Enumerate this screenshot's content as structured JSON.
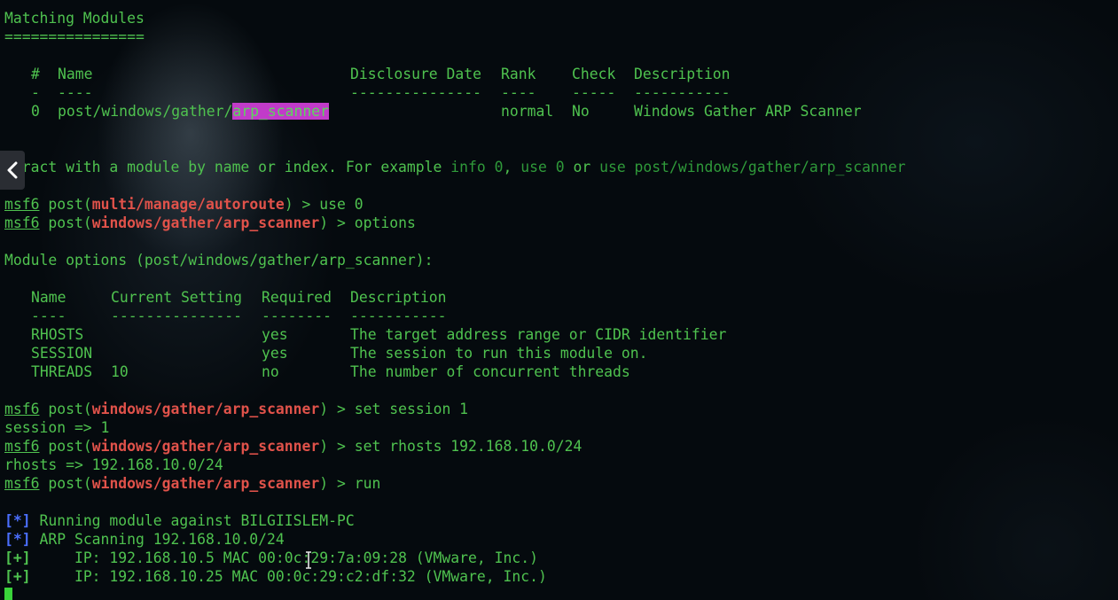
{
  "header": {
    "title": "Matching Modules",
    "underline": "================"
  },
  "modules_table": {
    "columns": [
      "#",
      "Name",
      "Disclosure Date",
      "Rank",
      "Check",
      "Description"
    ],
    "dashes": [
      "-",
      "----",
      "---------------",
      "----",
      "-----",
      "-----------"
    ],
    "rows": [
      {
        "index": "0",
        "name_prefix": "post/windows/gather/",
        "name_match": "arp_scanner",
        "disclosure": "",
        "rank": "normal",
        "check": "No",
        "description": "Windows Gather ARP Scanner"
      }
    ]
  },
  "hint": {
    "p1": "teract with a module by name or index. For example ",
    "e1": "info 0",
    "s1": ", ",
    "e2": "use 0",
    "s2": " or ",
    "e3": "use post/windows/gather/arp_scanner"
  },
  "prompts": [
    {
      "prefix": "msf6",
      "module_open": " post(",
      "module": "multi/manage/autoroute",
      "module_close": ")",
      "cmd": " > use 0"
    },
    {
      "prefix": "msf6",
      "module_open": " post(",
      "module": "windows/gather/arp_scanner",
      "module_close": ")",
      "cmd": " > options"
    }
  ],
  "options_title": "Module options (post/windows/gather/arp_scanner):",
  "options_table": {
    "columns": [
      "Name",
      "Current Setting",
      "Required",
      "Description"
    ],
    "dashes": [
      "----",
      "---------------",
      "--------",
      "-----------"
    ],
    "rows": [
      {
        "name": "RHOSTS",
        "setting": "",
        "required": "yes",
        "description": "The target address range or CIDR identifier"
      },
      {
        "name": "SESSION",
        "setting": "",
        "required": "yes",
        "description": "The session to run this module on."
      },
      {
        "name": "THREADS",
        "setting": "10",
        "required": "no",
        "description": "The number of concurrent threads"
      }
    ]
  },
  "session_cmds": [
    {
      "prefix": "msf6",
      "module_open": " post(",
      "module": "windows/gather/arp_scanner",
      "module_close": ")",
      "cmd": " > set session 1",
      "result": "session => 1"
    },
    {
      "prefix": "msf6",
      "module_open": " post(",
      "module": "windows/gather/arp_scanner",
      "module_close": ")",
      "cmd": " > set rhosts 192.168.10.0/24",
      "result": "rhosts => 192.168.10.0/24"
    },
    {
      "prefix": "msf6",
      "module_open": " post(",
      "module": "windows/gather/arp_scanner",
      "module_close": ")",
      "cmd": " > run",
      "result": ""
    }
  ],
  "output": [
    {
      "tag": "[*]",
      "text": " Running module against BILGIISLEM-PC"
    },
    {
      "tag": "[*]",
      "text": " ARP Scanning 192.168.10.0/24"
    },
    {
      "tag": "[+]",
      "text": "     IP: 192.168.10.5 MAC 00:0c:29:7a:09:28 (VMware, Inc.)"
    },
    {
      "tag": "[+]",
      "text": "     IP: 192.168.10.25 MAC 00:0c:29:c2:df:32 (VMware, Inc.)"
    }
  ],
  "icons": {
    "back": "chevron-left-icon",
    "cursor": "text-cursor-icon"
  },
  "colors": {
    "text": "#4fc24f",
    "module": "#e0524a",
    "highlight": "#c13bc9",
    "info_tag": "#4b6fff"
  }
}
